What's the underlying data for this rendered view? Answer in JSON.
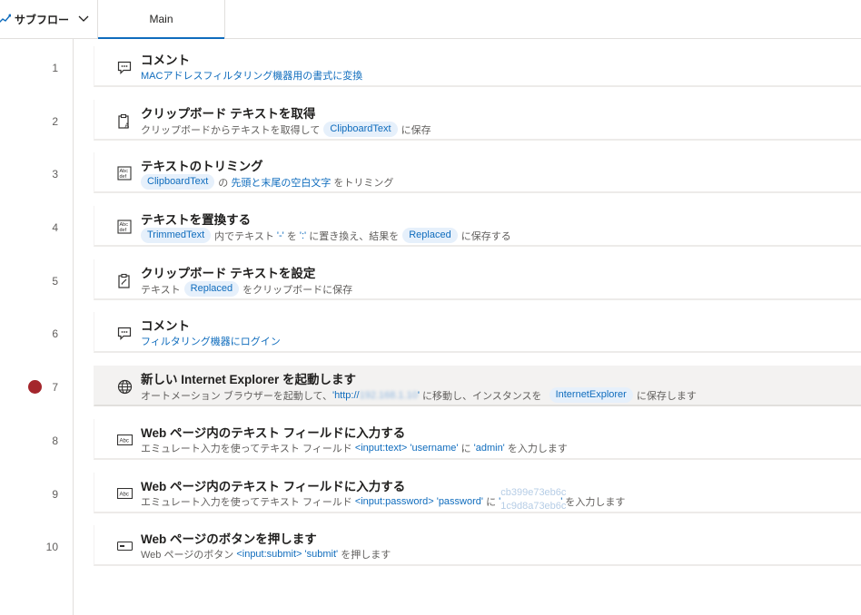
{
  "header": {
    "subflow_label": "サブフロー",
    "tab_main": "Main"
  },
  "actions": [
    {
      "num": "1",
      "icon": "comment-icon",
      "title": "コメント",
      "desc_text": "MACアドレスフィルタリング機器用の書式に変換"
    },
    {
      "num": "2",
      "icon": "clipboard-get-icon",
      "title": "クリップボード テキストを取得",
      "desc_pre": "クリップボードからテキストを取得して",
      "var1": "ClipboardText",
      "desc_post": "に保存"
    },
    {
      "num": "3",
      "icon": "text-icon",
      "title": "テキストのトリミング",
      "var1": "ClipboardText",
      "desc_mid": "の",
      "link1": "先頭と末尾の空白文字",
      "desc_post": "をトリミング"
    },
    {
      "num": "4",
      "icon": "text-icon",
      "title": "テキストを置換する",
      "var1": "TrimmedText",
      "desc_mid": "内でテキスト",
      "link1": "'-'",
      "desc_mid2": "を",
      "link2": "':'",
      "desc_mid3": "に置き換え、結果を",
      "var2": "Replaced",
      "desc_post": "に保存する"
    },
    {
      "num": "5",
      "icon": "clipboard-set-icon",
      "title": "クリップボード テキストを設定",
      "desc_pre": "テキスト",
      "var1": "Replaced",
      "desc_post": "をクリップボードに保存"
    },
    {
      "num": "6",
      "icon": "comment-icon",
      "title": "コメント",
      "desc_text": "フィルタリング機器にログイン"
    },
    {
      "num": "7",
      "icon": "globe-icon",
      "title": "新しい Internet Explorer を起動します",
      "desc_pre": "オートメーション ブラウザーを起動して、",
      "link1": "'http://",
      "blurred": "192.168.1.10",
      "link2": "'",
      "desc_mid": "に移動し、インスタンスを",
      "var1": "InternetExplorer",
      "desc_post": "に保存します",
      "breakpoint": true
    },
    {
      "num": "8",
      "icon": "textfield-icon",
      "title": "Web ページ内のテキスト フィールドに入力する",
      "desc_pre": "エミュレート入力を使ってテキスト フィールド",
      "link1": "<input:text>",
      "link2": "'username'",
      "desc_mid": "に",
      "link3": "'admin'",
      "desc_post": "を入力します"
    },
    {
      "num": "9",
      "icon": "textfield-icon",
      "title": "Web ページ内のテキスト フィールドに入力する",
      "desc_pre": "エミュレート入力を使ってテキスト フィールド",
      "link1": "<input:password>",
      "link2": "'password'",
      "desc_mid": "に",
      "link3": "'",
      "ghost1": "cb399e73eb6c",
      "ghost2": "1c9d8a73eb6c",
      "link4": "'",
      "desc_post": "を入力します"
    },
    {
      "num": "10",
      "icon": "button-icon",
      "title": "Web ページのボタンを押します",
      "desc_pre": "Web ページのボタン",
      "link1": "<input:submit>",
      "link2": "'submit'",
      "desc_post": "を押します"
    }
  ]
}
